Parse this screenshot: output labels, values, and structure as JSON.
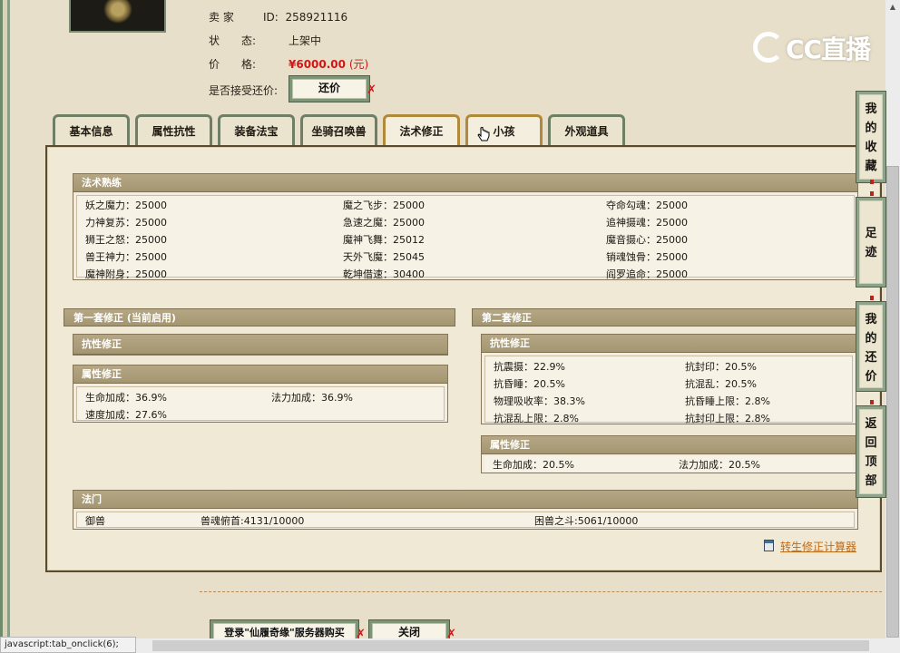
{
  "seller": {
    "seller_label": "卖 家",
    "id_label": "ID:",
    "id_value": "258921116",
    "status_label": "状　　态:",
    "status_value": "上架中",
    "price_label": "价　　格:",
    "price_value": "¥6000.00",
    "price_unit": "(元)",
    "accept_label": "是否接受还价:",
    "counter_button": "还价"
  },
  "tabs": [
    {
      "label": "基本信息"
    },
    {
      "label": "属性抗性"
    },
    {
      "label": "装备法宝"
    },
    {
      "label": "坐骑召唤兽"
    },
    {
      "label": "法术修正"
    },
    {
      "label": "小孩"
    },
    {
      "label": "外观道具"
    }
  ],
  "spell_mastery": {
    "title": "法术熟练",
    "rows": [
      [
        "妖之魔力：25000",
        "魔之飞步：25000",
        "夺命勾魂：25000"
      ],
      [
        "力神复苏：25000",
        "急速之魔：25000",
        "追神摄魂：25000"
      ],
      [
        "狮王之怒：25000",
        "魔神飞舞：25012",
        "魔音摄心：25000"
      ],
      [
        "兽王神力：25000",
        "天外飞魔：25045",
        "销魂蚀骨：25000"
      ],
      [
        "魔神附身：25000",
        "乾坤借速：30400",
        "阎罗追命：25000"
      ]
    ]
  },
  "set1": {
    "title": "第一套修正 (当前启用)",
    "resist_title": "抗性修正",
    "attr_title": "属性修正",
    "attr_rows": [
      [
        "生命加成：36.9%",
        "法力加成：36.9%"
      ],
      [
        "速度加成：27.6%",
        ""
      ]
    ]
  },
  "set2": {
    "title": "第二套修正",
    "resist_title": "抗性修正",
    "resist_rows": [
      [
        "抗震摄：22.9%",
        "抗封印：20.5%"
      ],
      [
        "抗昏睡：20.5%",
        "抗混乱：20.5%"
      ],
      [
        "物理吸收率：38.3%",
        "抗昏睡上限：2.8%"
      ],
      [
        "抗混乱上限：2.8%",
        "抗封印上限：2.8%"
      ]
    ],
    "attr_title": "属性修正",
    "attr_rows": [
      [
        "生命加成：20.5%",
        "法力加成：20.5%"
      ]
    ]
  },
  "school": {
    "title": "法门",
    "cells": [
      "御兽",
      "兽魂俯首:4131/10000",
      "困兽之斗:5061/10000"
    ]
  },
  "calc_link": "转生修正计算器",
  "bottom": {
    "login_button": "登录\"仙履奇缘\"服务器购买",
    "close_button": "关闭"
  },
  "side": {
    "favorites": "我的收藏",
    "footprint": "足迹",
    "my_offers": "我的还价",
    "back_top": "返回顶部"
  },
  "logo_text": "CC直播",
  "status_bar": "javascript:tab_onclick(6);",
  "colors": {
    "background": "#e7dfc9",
    "header_bar": "#a99a76",
    "price": "#d31515",
    "link": "#c06a16",
    "active_tab_border": "#b08a3a"
  }
}
